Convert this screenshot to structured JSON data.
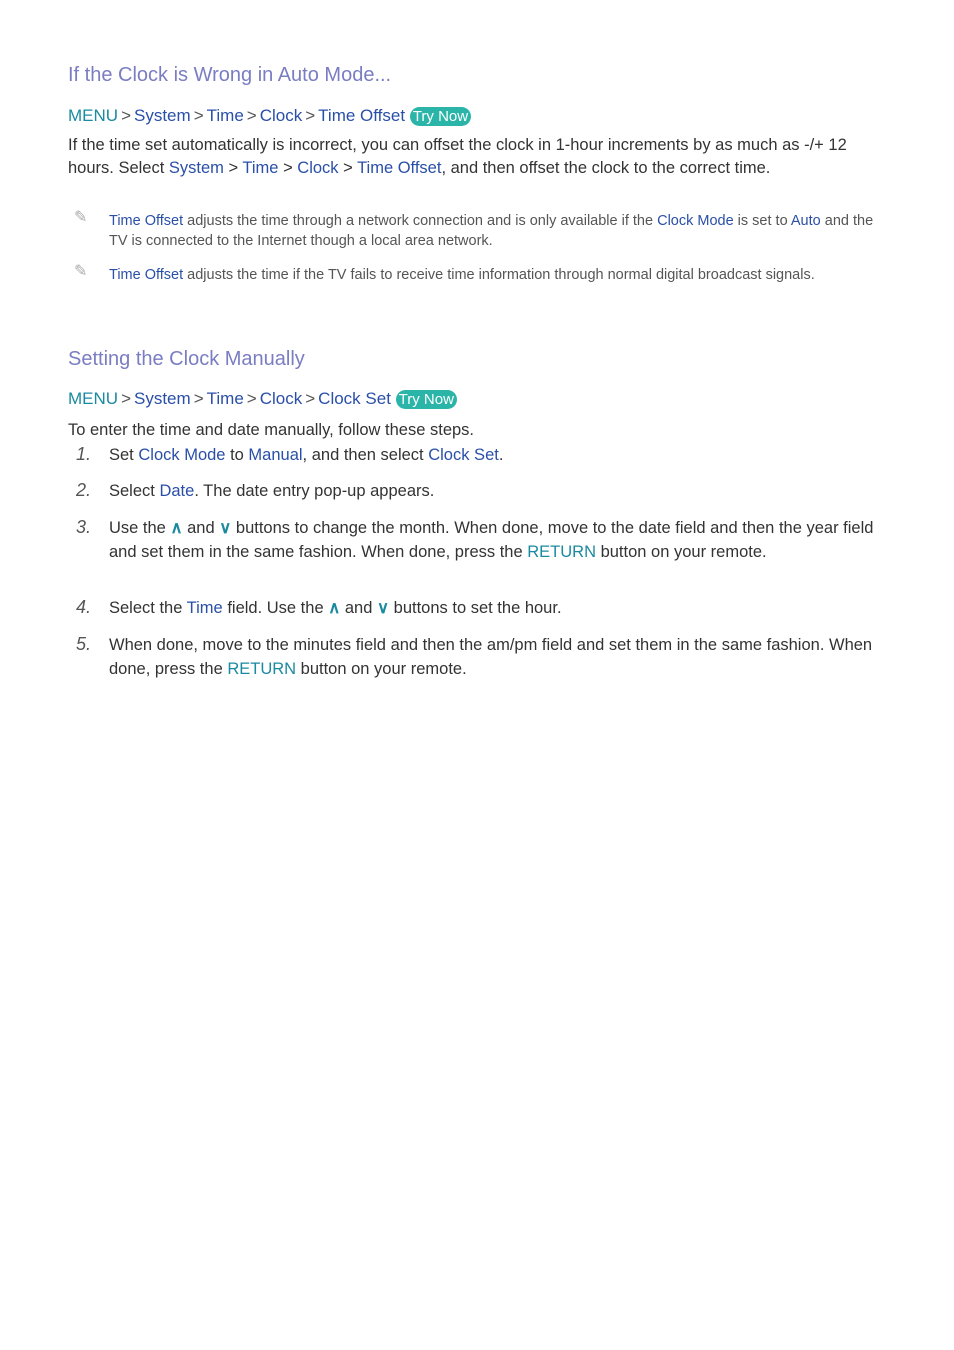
{
  "section1": {
    "heading": "If the Clock is Wrong in Auto Mode...",
    "path": [
      "MENU",
      "System",
      "Time",
      "Clock",
      "Time Offset"
    ],
    "try_now": "Try Now",
    "body": {
      "a": "If the time set automatically is incorrect, you can offset the clock in 1-hour increments by as much as -/+ 12 hours. Select ",
      "l1": "System",
      "l2": "Time",
      "l3": "Clock",
      "l4": "Time Offset",
      "b": ", and then offset the clock to the correct time."
    },
    "notes": [
      {
        "k1": "Time Offset",
        "t1": " adjusts the time through a network connection and is only available if the ",
        "k2": "Clock Mode",
        "t2": " is set to ",
        "k3": "Auto",
        "t3": " and the TV is connected to the Internet though a local area network."
      },
      {
        "k1": "Time Offset",
        "t1": " adjusts the time if the TV fails to receive time information through normal digital broadcast signals."
      }
    ]
  },
  "section2": {
    "heading": "Setting the Clock Manually",
    "path": [
      "MENU",
      "System",
      "Time",
      "Clock",
      "Clock Set"
    ],
    "try_now": "Try Now",
    "intro": "To enter the time and date manually, follow these steps.",
    "steps": [
      {
        "num": "1.",
        "a": "Set ",
        "k1": "Clock Mode",
        "b": " to ",
        "k2": "Manual",
        "c": ", and then select ",
        "k3": "Clock Set",
        "d": "."
      },
      {
        "num": "2.",
        "a": "Select ",
        "k1": "Date",
        "b": ". The date entry pop-up appears."
      },
      {
        "num": "3.",
        "a": "Use the ",
        "b": " and ",
        "c": " buttons to change the month. When done, move to the date field and then the year field and set them in the same fashion. When done, press the ",
        "k1": "RETURN",
        "d": " button on your remote."
      },
      {
        "num": "4.",
        "a": "Select the ",
        "k1": "Time",
        "b": " field. Use the ",
        "c": " and ",
        "d": " buttons to set the hour."
      },
      {
        "num": "5.",
        "a": "When done, move to the minutes field and then the am/pm field and set them in the same fashion. When done, press the ",
        "k1": "RETURN",
        "b": " button on your remote."
      }
    ]
  },
  "icons": {
    "sep": ">",
    "up": "∧",
    "down": "∨",
    "pencil": "✎"
  }
}
